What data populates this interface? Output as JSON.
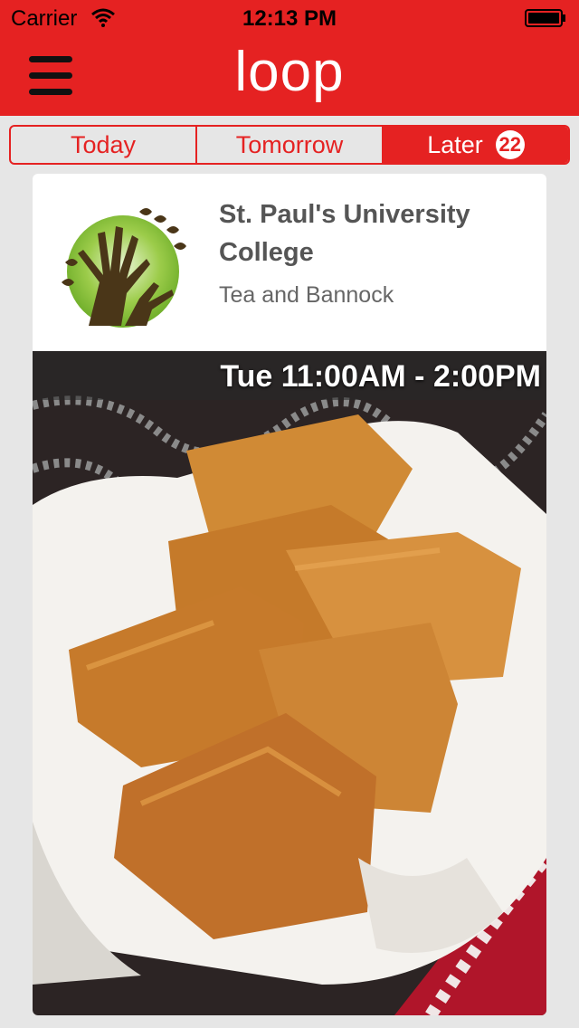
{
  "status_bar": {
    "carrier": "Carrier",
    "time": "12:13 PM"
  },
  "nav": {
    "logo": "loop",
    "menu_icon": "hamburger-menu-icon"
  },
  "tabs": [
    {
      "label": "Today",
      "active": false
    },
    {
      "label": "Tomorrow",
      "active": false
    },
    {
      "label": "Later",
      "active": true,
      "badge": "22"
    }
  ],
  "event": {
    "organizer": "St. Paul's University College",
    "title": "Tea and Bannock",
    "time": "Tue 11:00AM - 2:00PM"
  },
  "colors": {
    "brand": "#e52222",
    "background": "#e6e6e6"
  }
}
